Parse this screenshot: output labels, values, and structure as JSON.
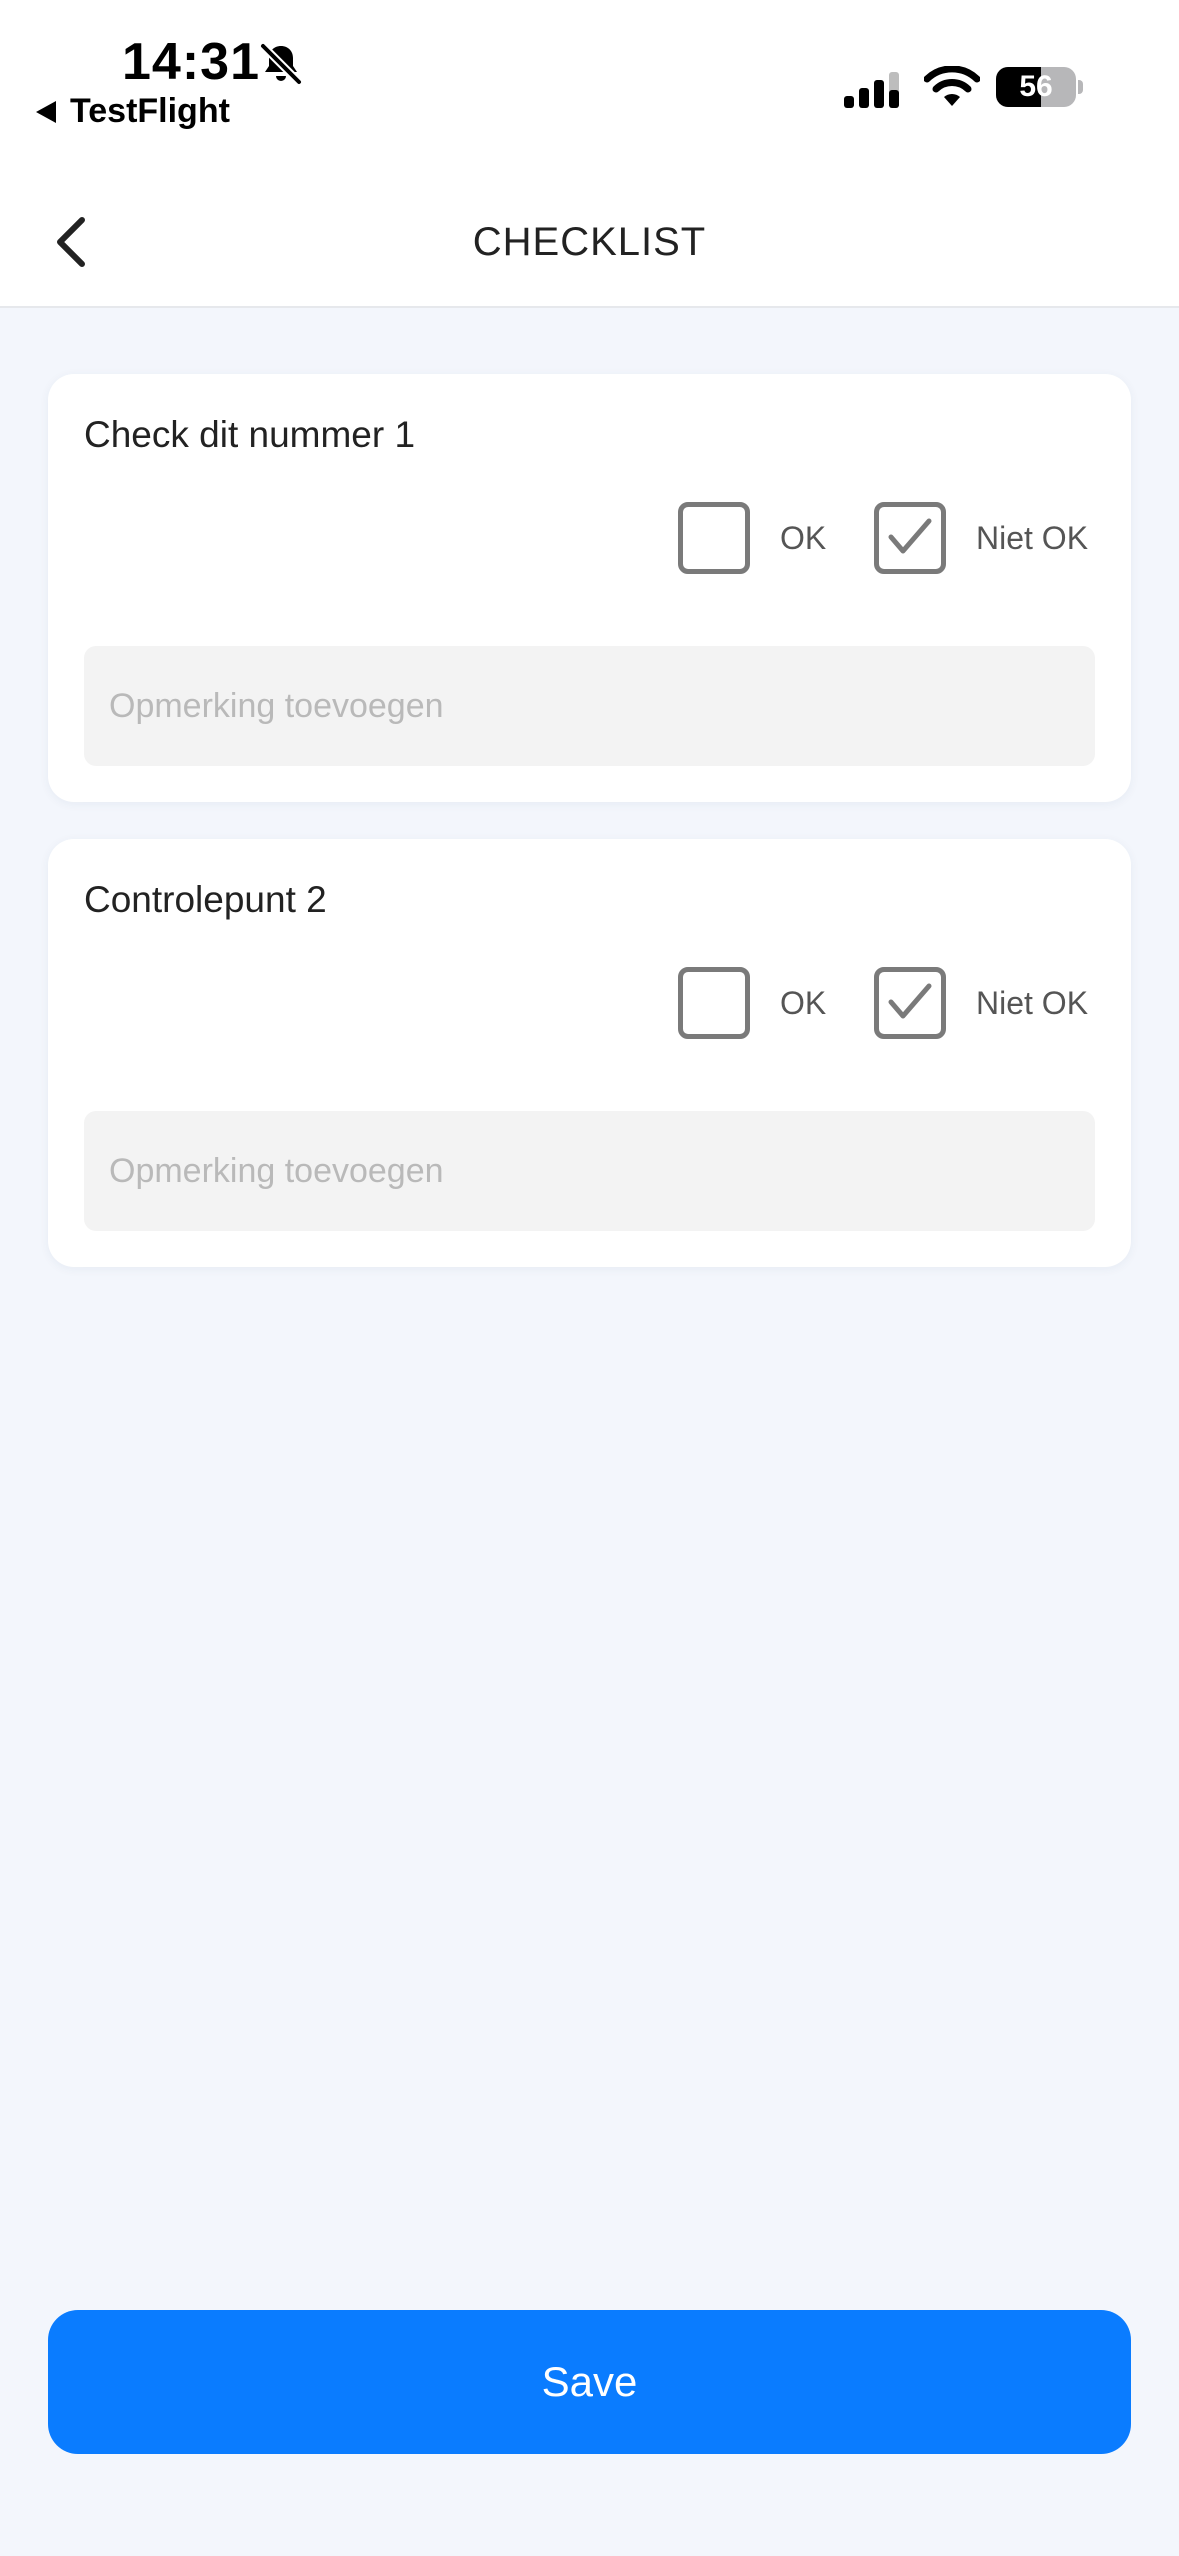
{
  "status_bar": {
    "time": "14:31",
    "back_app": "TestFlight",
    "battery_percent": "56",
    "battery_level": 0.56,
    "icons": [
      "bell-slash-icon",
      "cellular-signal-icon",
      "wifi-icon",
      "battery-icon"
    ]
  },
  "nav": {
    "title": "CHECKLIST",
    "back_icon": "chevron-left-icon"
  },
  "items": [
    {
      "title": "Check dit nummer 1",
      "ok_label": "OK",
      "not_ok_label": "Niet OK",
      "ok_checked": false,
      "not_ok_checked": true,
      "remark_value": "",
      "remark_placeholder": "Opmerking toevoegen"
    },
    {
      "title": "Controlepunt 2",
      "ok_label": "OK",
      "not_ok_label": "Niet OK",
      "ok_checked": false,
      "not_ok_checked": true,
      "remark_value": "",
      "remark_placeholder": "Opmerking toevoegen"
    }
  ],
  "save_label": "Save",
  "colors": {
    "accent": "#0a7cff",
    "background": "#f3f6fc",
    "checkbox_border": "#7a7a7a"
  }
}
